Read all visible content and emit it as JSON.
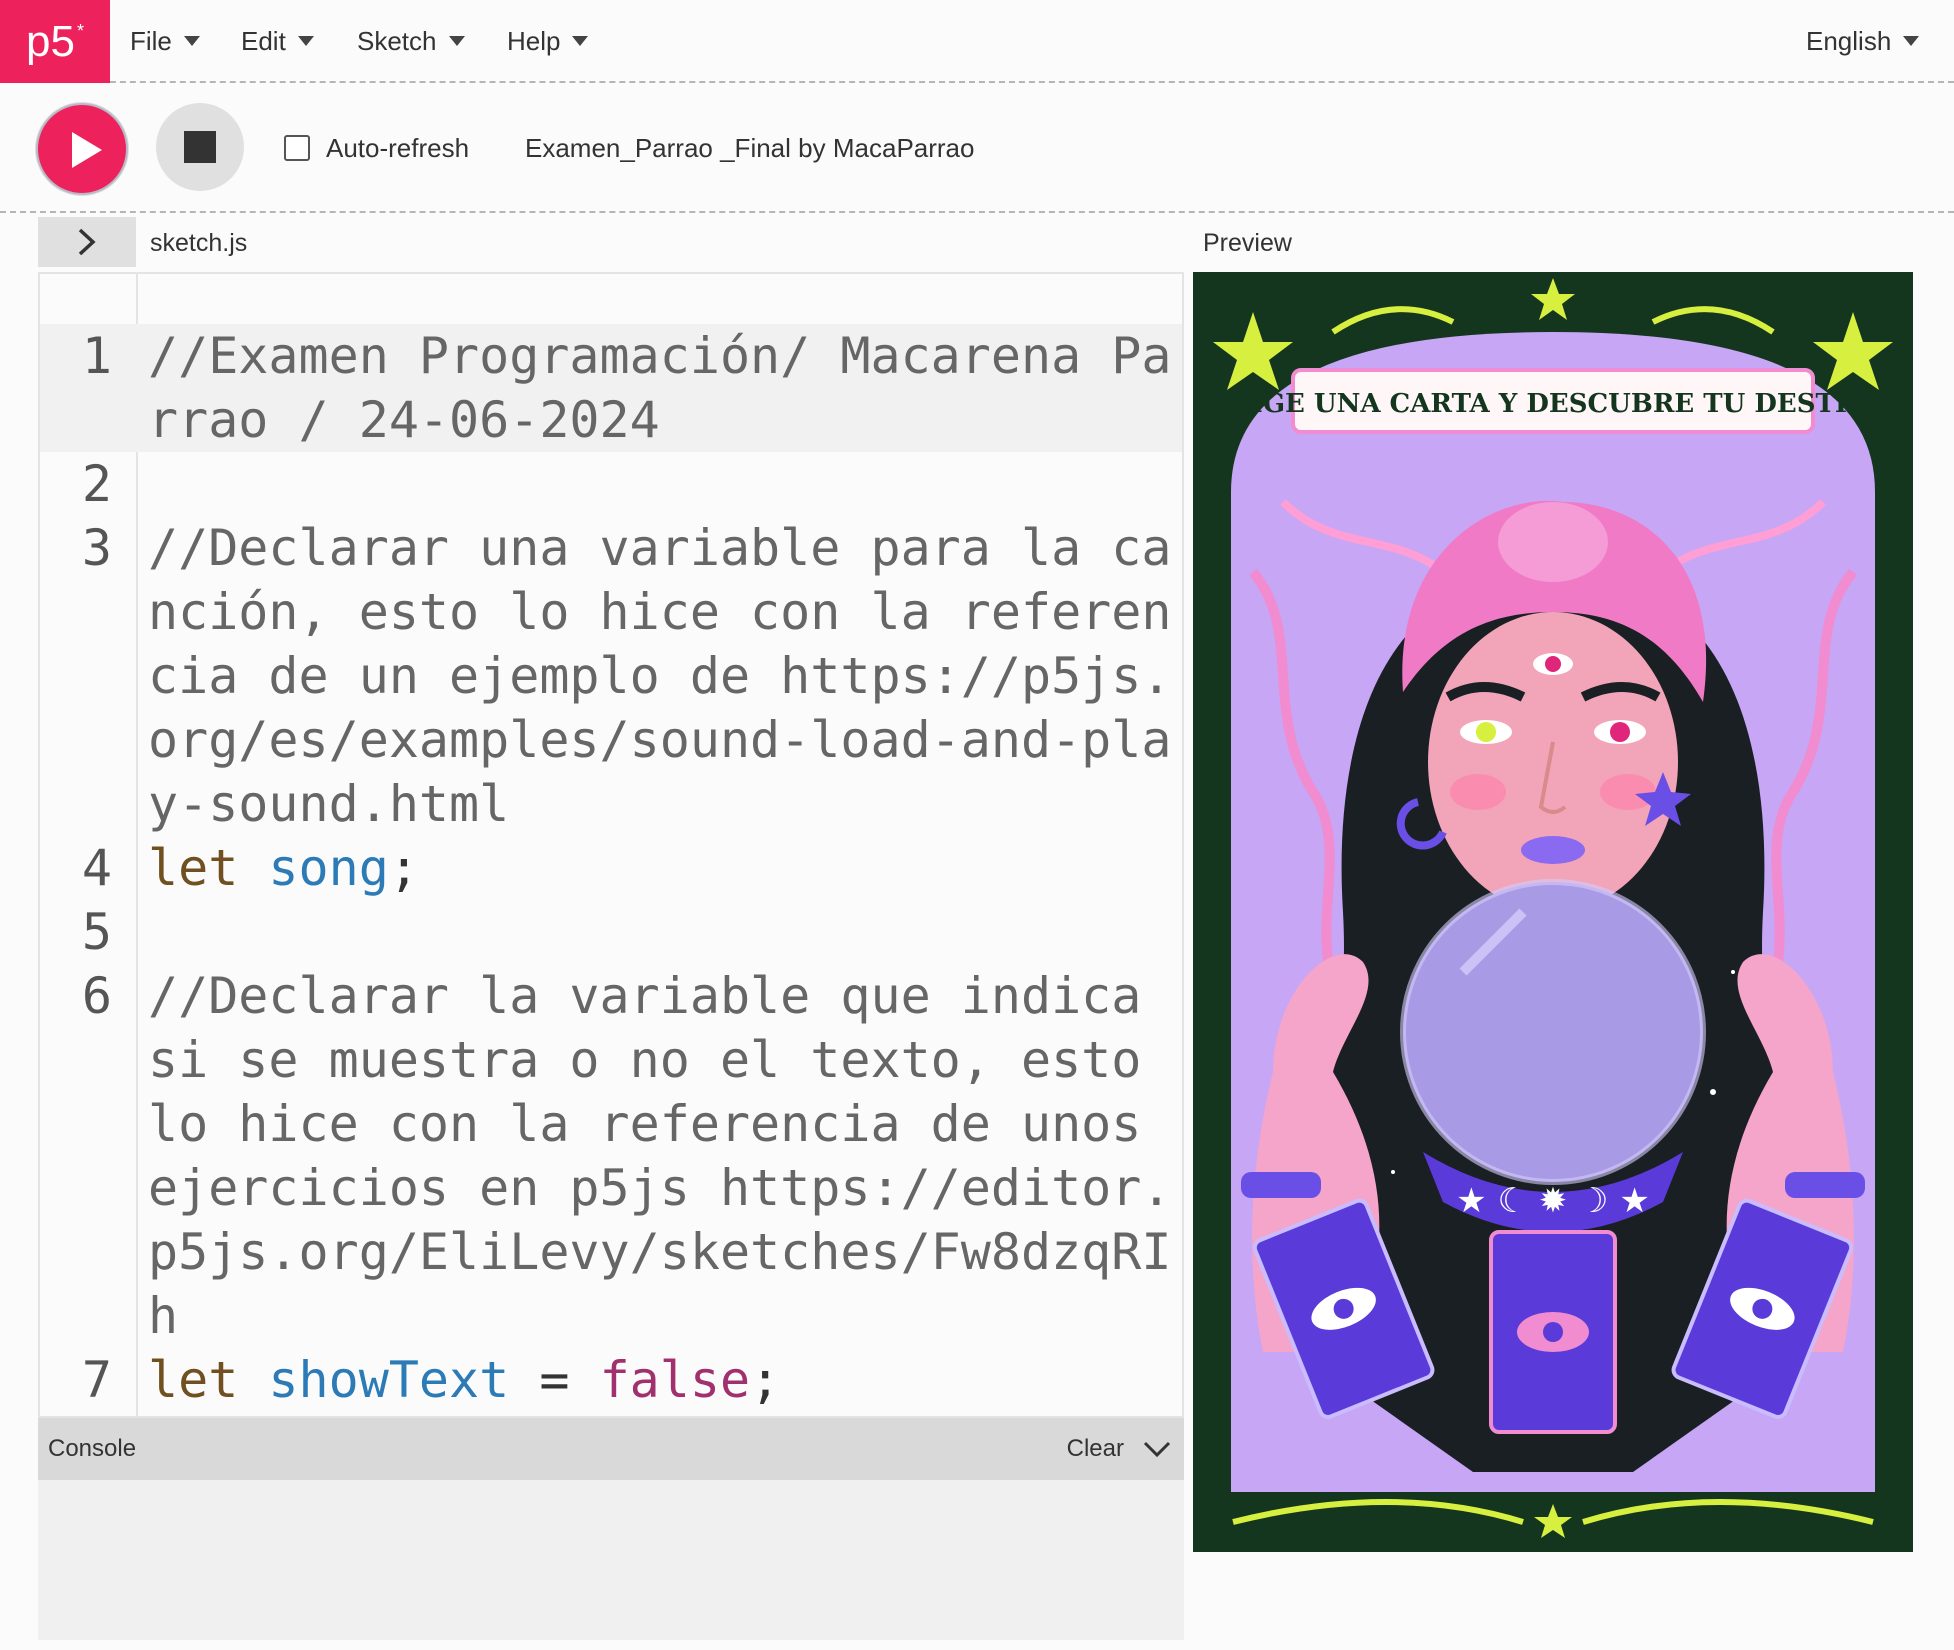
{
  "nav": {
    "logo": "p5",
    "logo_sup": "*",
    "menu": [
      {
        "label": "File"
      },
      {
        "label": "Edit"
      },
      {
        "label": "Sketch"
      },
      {
        "label": "Help"
      }
    ],
    "language": "English"
  },
  "toolbar": {
    "auto_refresh_label": "Auto-refresh",
    "auto_refresh_checked": false,
    "sketch_name": "Examen_Parrao _Final",
    "by_label": "by",
    "author": "MacaParrao"
  },
  "editor": {
    "filename": "sketch.js",
    "lines": [
      {
        "num": "1",
        "text": "//Examen Programación/ Macarena Parrao / 24-06-2024"
      },
      {
        "num": "2",
        "text": ""
      },
      {
        "num": "3",
        "text": "//Declarar una variable para la canción, esto lo hice con la referencia de un ejemplo de https://p5js.org/es/examples/sound-load-and-play-sound.html"
      },
      {
        "num": "4",
        "kw": "let",
        "var": "song",
        "end": ";"
      },
      {
        "num": "5",
        "text": ""
      },
      {
        "num": "6",
        "text": "//Declarar la variable que indica si se muestra o no el texto, esto lo hice con la referencia de unos ejercicios en p5js https://editor.p5js.org/EliLevy/sketches/Fw8dzqRIh"
      },
      {
        "num": "7",
        "kw": "let",
        "var": "showText",
        "op": " = ",
        "bool": "false",
        "end": ";"
      }
    ]
  },
  "console": {
    "label": "Console",
    "clear": "Clear"
  },
  "preview": {
    "label": "Preview",
    "banner": "ELIGE UNA CARTA Y DESCUBRE TU DESTINO"
  },
  "colors": {
    "accent": "#ed225d",
    "card_border": "#14361f",
    "card_bg": "#c7a6f5",
    "hair": "#1a1f24",
    "turban": "#f07ac6",
    "orb": "#a99ae6",
    "tarot": "#5a3bd9",
    "ornament": "#d7ef3e"
  }
}
